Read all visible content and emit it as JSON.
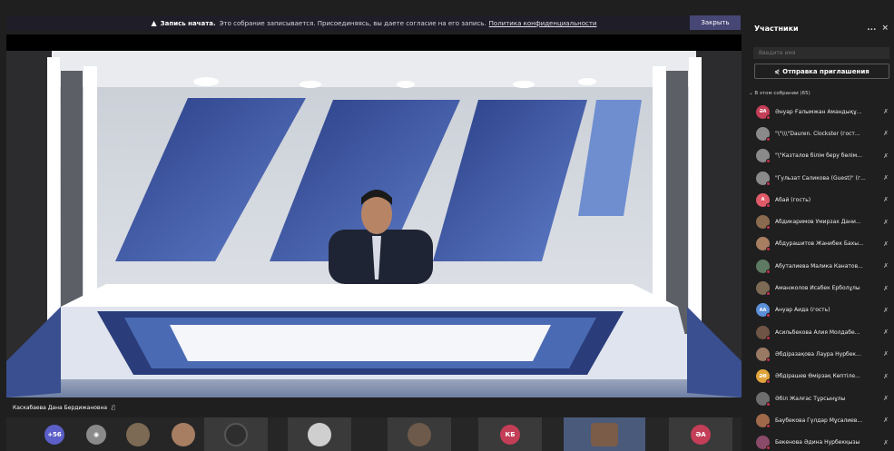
{
  "banner": {
    "title": "Запись начата.",
    "message": "Это собрание записывается. Присоединяясь, вы даете согласие на его запись.",
    "link": "Политика конфиденциальности",
    "close_label": "Закрыть"
  },
  "stage": {
    "speaker_name": "Каскабаева Дана Бердижановна"
  },
  "strip": {
    "overflow_count": "+56",
    "initials": [
      {
        "text": "КБ",
        "color": "#c43e57"
      },
      {
        "text": "ӘА",
        "color": "#c43e57"
      }
    ]
  },
  "panel": {
    "title": "Участники",
    "more": "...",
    "close": "×",
    "search_placeholder": "Введите имя",
    "invite_label": "Отправка приглашения",
    "section_label": "В этом собрании (65)",
    "participants": [
      {
        "name": "Әнуар Ғалымжан Амандықұ...",
        "initials": "ӘА",
        "color": "#c43e57"
      },
      {
        "name": "\"\\\"\\\\\\\"Dauren. Clockster (гост...",
        "initials": "",
        "color": "#8a8a8a"
      },
      {
        "name": "\"\\\"Казталов білім беру бөлім...",
        "initials": "",
        "color": "#8a8a8a"
      },
      {
        "name": "\"Гульзат Саликова (Guest)\" (г...",
        "initials": "",
        "color": "#8a8a8a"
      },
      {
        "name": "Абай (гость)",
        "initials": "А",
        "color": "#e05a6a"
      },
      {
        "name": "Абдикаримов Умирзах Дани...",
        "initials": "",
        "color": "#8a6b4f"
      },
      {
        "name": "Абдурашитов Жанибек Бахы...",
        "initials": "",
        "color": "#a77e62"
      },
      {
        "name": "Абуталиева Малика Канатов...",
        "initials": "",
        "color": "#5f7a62"
      },
      {
        "name": "Аманжолов Исабек Ерболұлы",
        "initials": "",
        "color": "#7d6a55"
      },
      {
        "name": "Ануар Аида (гость)",
        "initials": "АА",
        "color": "#5b8fd8"
      },
      {
        "name": "Асильбекова Алия Молдабе...",
        "initials": "",
        "color": "#6f5545"
      },
      {
        "name": "Әбдіразақова Лаура Нурбек...",
        "initials": "",
        "color": "#9a7a65"
      },
      {
        "name": "Әбдірашев Өмірзақ Көптіле...",
        "initials": "ӘӨ",
        "color": "#e0a43a"
      },
      {
        "name": "Әбіл Жалғас Тұрсынұлы",
        "initials": "",
        "color": "#6e6e6e"
      },
      {
        "name": "Баубекова Гүлдар Мұсалиев...",
        "initials": "",
        "color": "#a06a4a"
      },
      {
        "name": "Бекенова Әдина Нурбекқызы",
        "initials": "",
        "color": "#8a4a6a"
      }
    ]
  }
}
